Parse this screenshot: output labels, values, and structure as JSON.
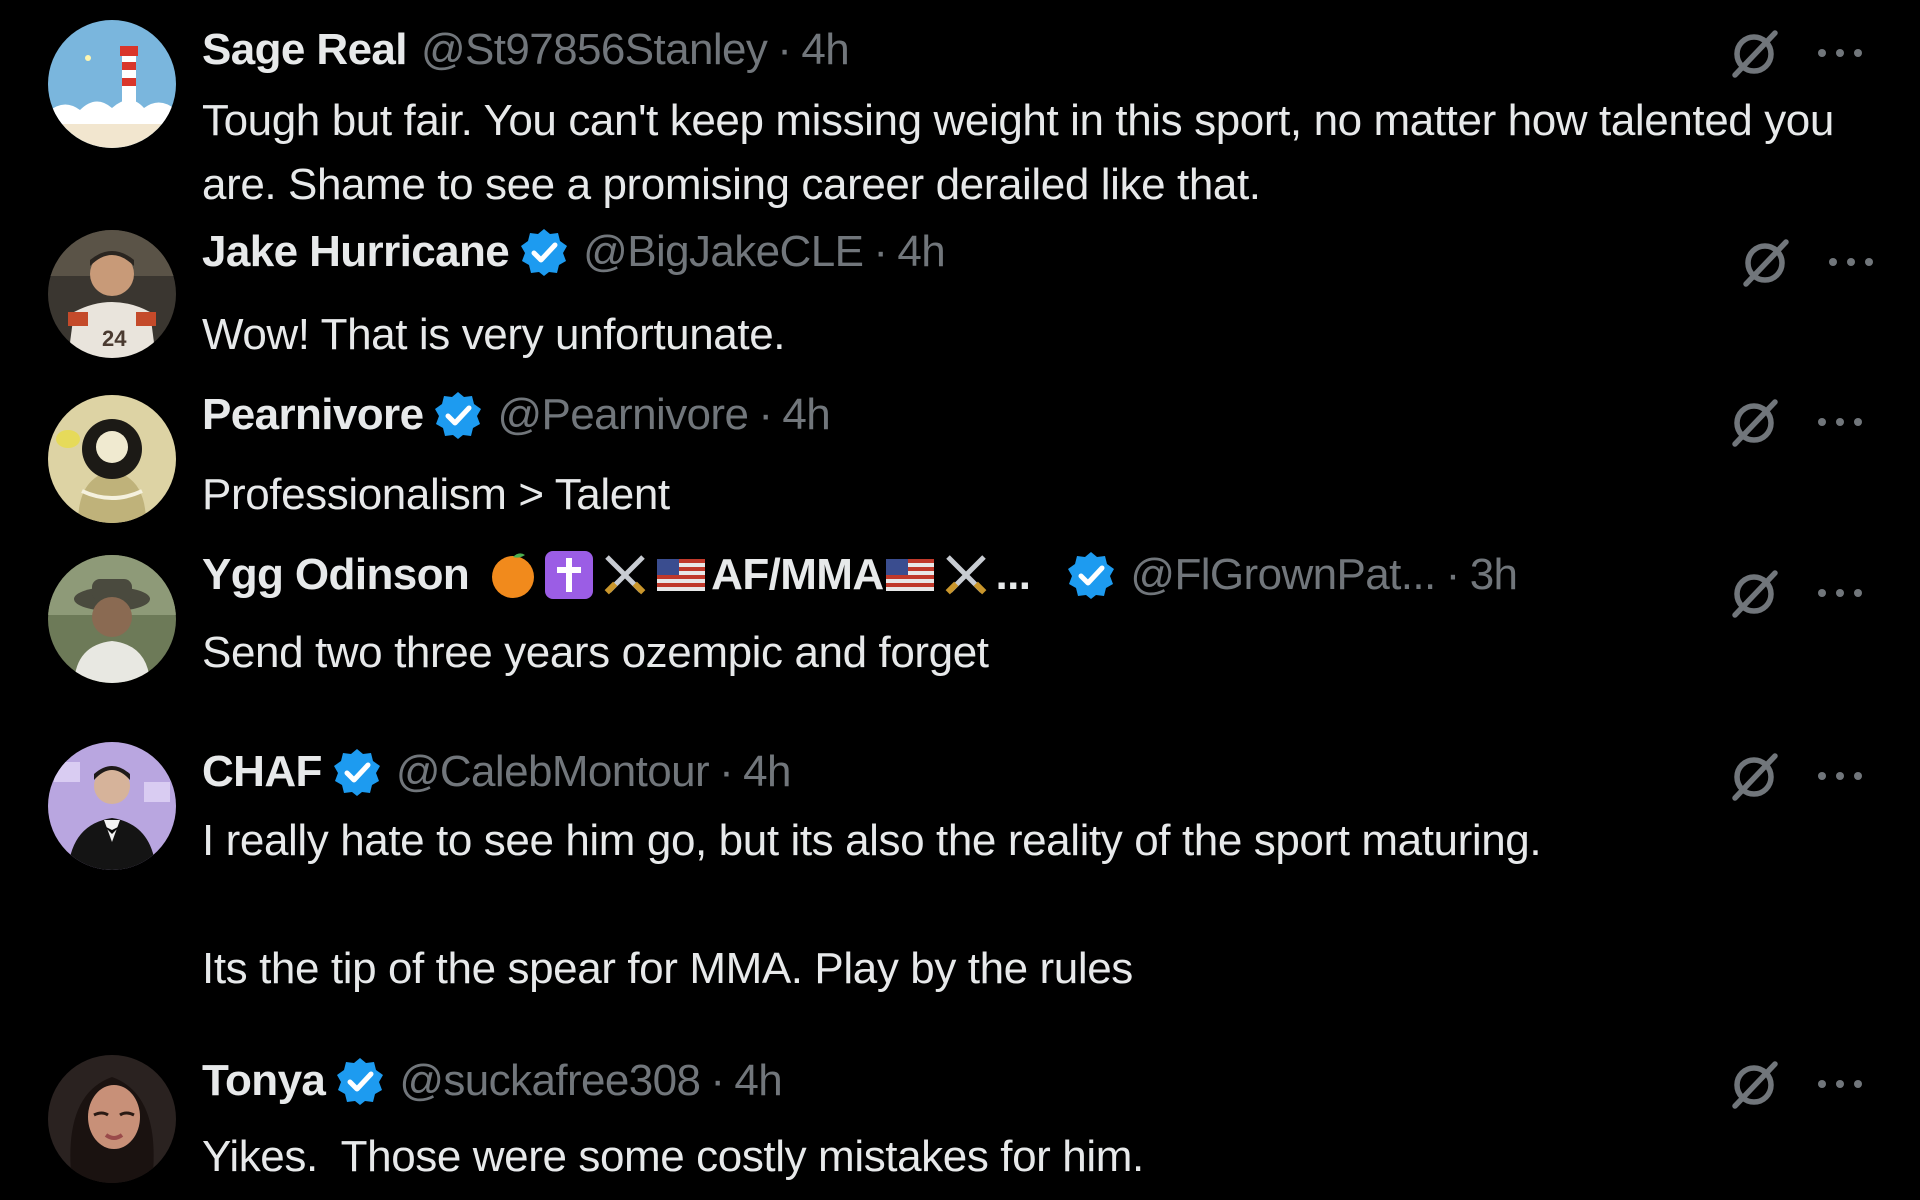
{
  "replies": [
    {
      "name": "Sage Real",
      "handle": "@St97856Stanley",
      "separator": "·",
      "time": "4h",
      "text": "Tough but fair. You can't keep missing weight in this sport, no matter how talented you are. Shame to see a promising career derailed like that.",
      "verified": false,
      "avatar": "lighthouse-avatar"
    },
    {
      "name": "Jake Hurricane",
      "handle": "@BigJakeCLE",
      "separator": "·",
      "time": "4h",
      "text": "Wow! That is very unfortunate.",
      "verified": true,
      "avatar": "jersey-avatar"
    },
    {
      "name": "Pearnivore",
      "handle": "@Pearnivore",
      "separator": "·",
      "time": "4h",
      "text": "Professionalism > Talent",
      "verified": true,
      "avatar": "cartoon-avatar"
    },
    {
      "name": "Ygg Odinson",
      "name_suffix": "AF/MMA",
      "name_ellipsis": "...",
      "emoji_names": [
        "orange-emoji",
        "latin-cross-emoji",
        "crossed-swords-emoji",
        "us-flag-emoji",
        "us-flag-emoji",
        "crossed-swords-emoji"
      ],
      "handle": "@FlGrownPat...",
      "separator": "·",
      "time": "3h",
      "text": "Send two three years ozempic and forget",
      "verified": true,
      "avatar": "hat-avatar"
    },
    {
      "name": "CHAF",
      "handle": "@CalebMontour",
      "separator": "·",
      "time": "4h",
      "text": "I really hate to see him go, but its also the reality of the sport maturing.\n\nIts the tip of the spear for MMA. Play by the rules",
      "verified": true,
      "avatar": "tuxedo-avatar"
    },
    {
      "name": "Tonya",
      "handle": "@suckafree308",
      "separator": "·",
      "time": "4h",
      "text": "Yikes.  Those were some costly mistakes for him.",
      "verified": true,
      "avatar": "portrait-avatar"
    }
  ],
  "colors": {
    "background": "#000000",
    "primary_text": "#e7e9ea",
    "secondary_text": "#71767b",
    "verified_badge": "#1d9bf0"
  },
  "icons": {
    "action": "grok-icon",
    "menu": "more-icon"
  }
}
